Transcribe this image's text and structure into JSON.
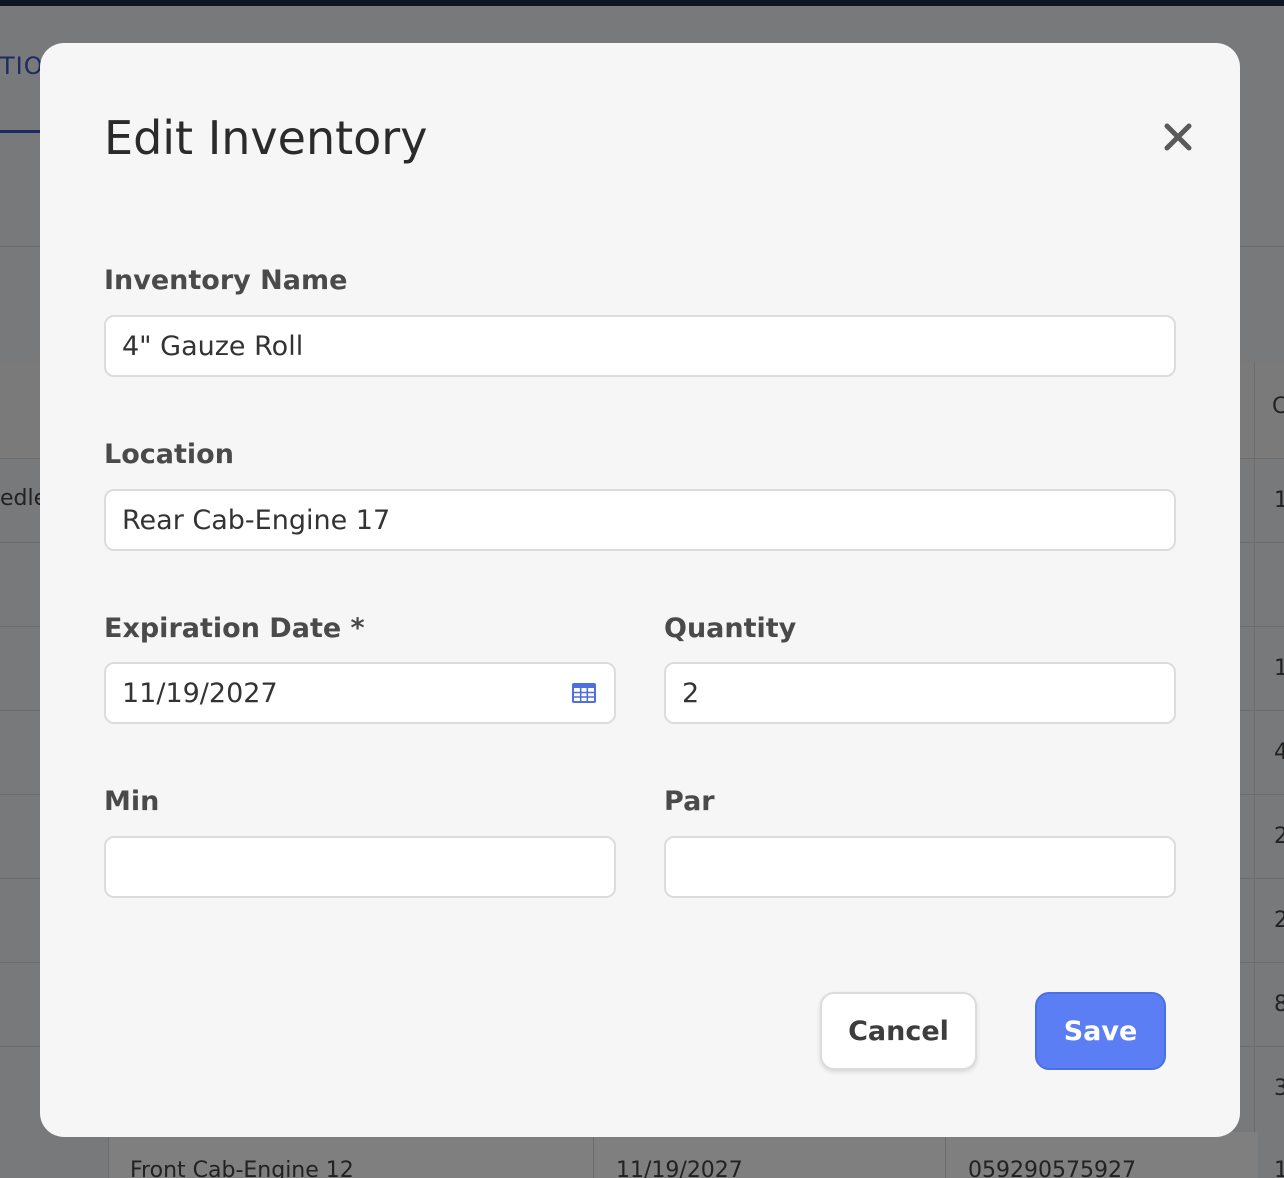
{
  "background": {
    "tab_fragment": "TIO",
    "header_fragment": "C",
    "row_fragment": "edle",
    "right_column_fragments": [
      "1",
      "1",
      "4",
      "2",
      "2",
      "8",
      "3",
      "1"
    ],
    "bottom_row": {
      "location": "Front Cab-Engine 12",
      "date": "11/19/2027",
      "code": "059290575927"
    }
  },
  "modal": {
    "title": "Edit Inventory",
    "close_icon": "close-x-icon",
    "fields": {
      "inventory_name": {
        "label": "Inventory Name",
        "value": "4\" Gauze Roll"
      },
      "location": {
        "label": "Location",
        "value": "Rear Cab-Engine 17"
      },
      "expiration_date": {
        "label": "Expiration Date *",
        "value": "11/19/2027",
        "icon": "calendar-icon"
      },
      "quantity": {
        "label": "Quantity",
        "value": "2"
      },
      "min": {
        "label": "Min",
        "value": ""
      },
      "par": {
        "label": "Par",
        "value": ""
      }
    },
    "buttons": {
      "cancel": "Cancel",
      "save": "Save"
    }
  },
  "colors": {
    "accent": "#5b7ef5",
    "calendar_icon": "#4f6fe0",
    "top_bar": "#1a2a48"
  }
}
